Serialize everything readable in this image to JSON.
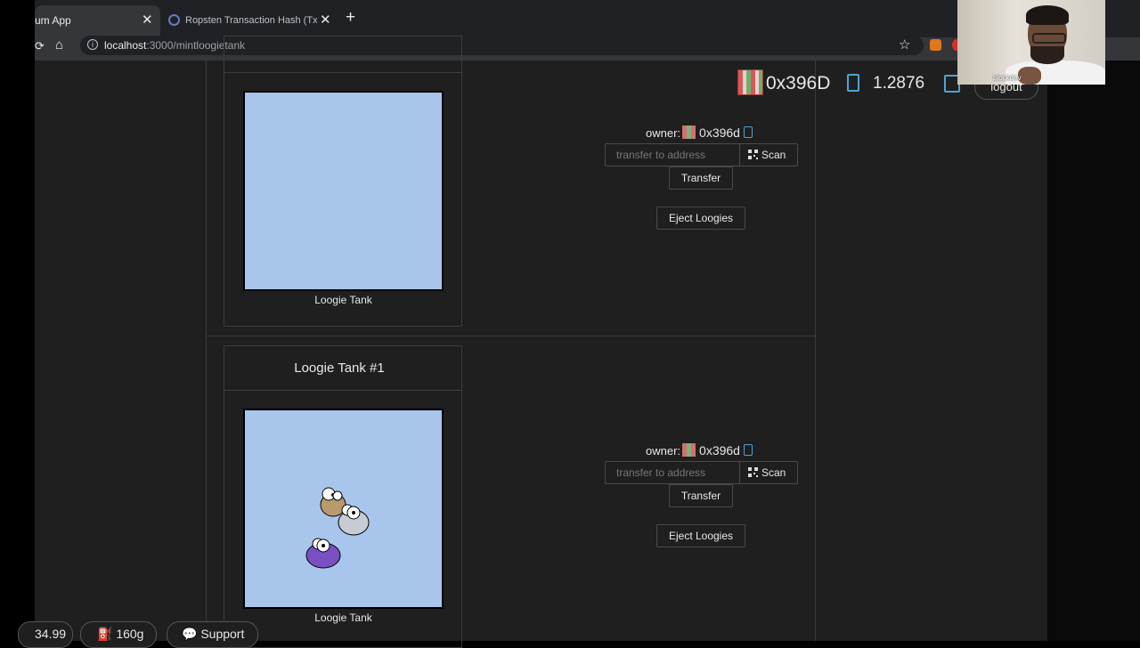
{
  "browser": {
    "tabs": [
      {
        "title": "um App",
        "active": true
      },
      {
        "title": "Ropsten Transaction Hash (Tx"
      }
    ],
    "tab_close": "✕",
    "new_tab": "+",
    "url_host": "localhost",
    "url_path": ":3000/mintloogietank"
  },
  "header": {
    "address": "0x396D",
    "balance": "1.2876",
    "logout_label": "logout"
  },
  "webcam": {
    "name": "blockdev"
  },
  "cards": [
    {
      "title": "",
      "caption": "Loogie Tank",
      "owner_label": "owner:",
      "owner_address": "0x396d",
      "transfer_placeholder": "transfer to address",
      "scan_label": "Scan",
      "transfer_label": "Transfer",
      "eject_label": "Eject Loogies",
      "loogies": []
    },
    {
      "title": "Loogie Tank #1",
      "caption": "Loogie Tank",
      "owner_label": "owner:",
      "owner_address": "0x396d",
      "transfer_placeholder": "transfer to address",
      "scan_label": "Scan",
      "transfer_label": "Transfer",
      "eject_label": "Eject Loogies",
      "loogies": [
        {
          "color": "#b79a6e"
        },
        {
          "color": "#c7ccd4"
        },
        {
          "color": "#7a4fc4"
        }
      ]
    }
  ],
  "footer": {
    "price": "34.99",
    "gas": "160g",
    "support_label": "Support"
  },
  "colors": {
    "background": "#1f1f1f",
    "tank_water": "#a8c5ec",
    "accent_icon": "#4ea3d6"
  }
}
